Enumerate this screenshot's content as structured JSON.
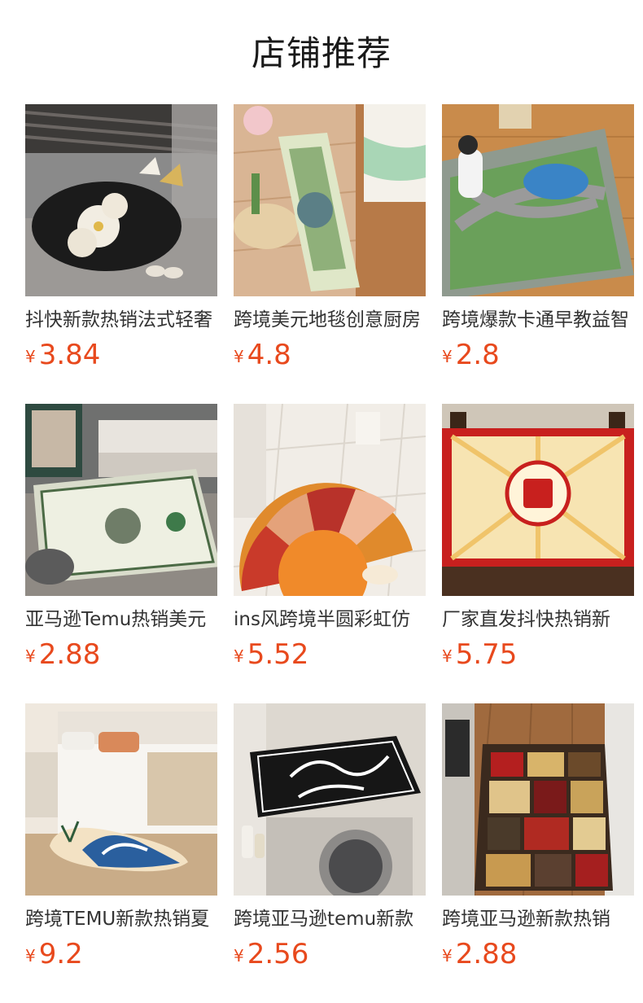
{
  "page": {
    "title": "店铺推荐"
  },
  "colors": {
    "price": "#e8491d",
    "text": "#333333"
  },
  "products": [
    {
      "name": "抖快新款热销法式轻奢",
      "currency": "¥",
      "price": "3.84",
      "image": "butterfly-flower-mat-image"
    },
    {
      "name": "跨境美元地毯创意厨房",
      "currency": "¥",
      "price": "4.8",
      "image": "banknote-runner-rug-image"
    },
    {
      "name": "跨境爆款卡通早教益智",
      "currency": "¥",
      "price": "2.8",
      "image": "kids-road-map-rug-image"
    },
    {
      "name": "亚马逊Temu热销美元",
      "currency": "¥",
      "price": "2.88",
      "image": "dollar-bill-rug-image"
    },
    {
      "name": "ins风跨境半圆彩虹仿",
      "currency": "¥",
      "price": "5.52",
      "image": "rainbow-half-circle-mat-image"
    },
    {
      "name": "厂家直发抖快热销新",
      "currency": "¥",
      "price": "5.75",
      "image": "mahjong-table-mat-image"
    },
    {
      "name": "跨境TEMU新款热销夏",
      "currency": "¥",
      "price": "9.2",
      "image": "surfboard-wave-rug-image"
    },
    {
      "name": "跨境亚马逊temu新款",
      "currency": "¥",
      "price": "2.56",
      "image": "laundry-room-cover-image"
    },
    {
      "name": "跨境亚马逊新款热销",
      "currency": "¥",
      "price": "2.88",
      "image": "patchwork-runner-rug-image"
    }
  ]
}
